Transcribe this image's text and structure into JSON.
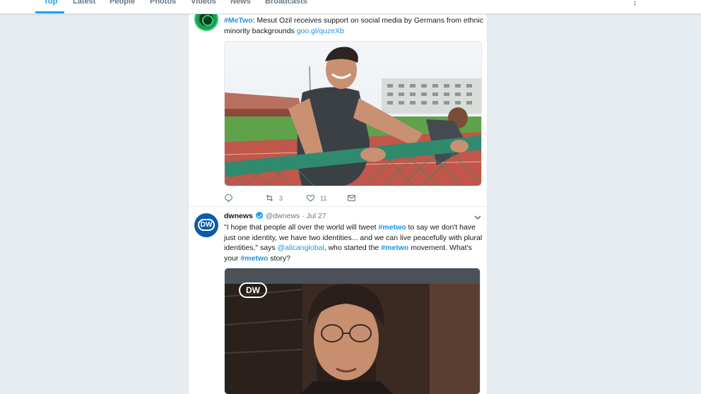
{
  "nav": {
    "tabs": [
      {
        "label": "Top",
        "active": true
      },
      {
        "label": "Latest"
      },
      {
        "label": "People"
      },
      {
        "label": "Photos"
      },
      {
        "label": "Videos"
      },
      {
        "label": "News"
      },
      {
        "label": "Broadcasts"
      }
    ],
    "more_icon": "more-vertical-icon"
  },
  "tweets": [
    {
      "avatar_icon": "green-logo-avatar",
      "text_hashtag": "#MeTwo",
      "text_body": ": Mesut Ozil receives support on social media by Germans from ethnic minority backgrounds ",
      "text_link": "goo.gl/quzeXb",
      "actions": {
        "reply_icon": "reply-icon",
        "retweets": "3",
        "likes": "11",
        "dm_icon": "envelope-icon"
      }
    },
    {
      "avatar_logo": "DW",
      "name": "dwnews",
      "handle": "@dwnews",
      "date": "Jul 27",
      "seg1": "\"I hope that people all over the world will tweet ",
      "tag1": "#metwo",
      "seg2": " to say we don't have just one identity, we have two identities... and we can live peacefully with plural identities,\" says ",
      "mention": "@alicanglobal",
      "seg3": ", who started the ",
      "tag2": "#metwo",
      "seg4": " movement. What's your ",
      "tag3": "#metwo",
      "seg5": " story?",
      "video_watermark": "DW"
    }
  ],
  "colors": {
    "accent": "#1da1f2",
    "link": "#1b95e0",
    "background": "#e6ecf0"
  }
}
